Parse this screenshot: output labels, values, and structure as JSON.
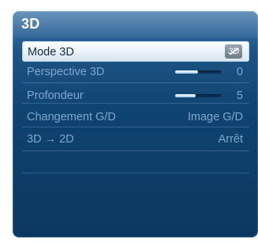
{
  "menu": {
    "title": "3D",
    "items": [
      {
        "label": "Mode 3D",
        "icon": "3d-off-icon",
        "icon_text": "3D",
        "selected": true
      },
      {
        "label": "Perspective 3D",
        "value": "0",
        "slider_fraction": 0.5
      },
      {
        "label": "Profondeur",
        "value": "5",
        "slider_fraction": 0.45
      },
      {
        "label": "Changement G/D",
        "value": "Image G/D"
      },
      {
        "label": "3D → 2D",
        "value": "Arrêt"
      }
    ]
  },
  "colors": {
    "panel": "#0f4370",
    "selected_bg": "#ffffff",
    "dim_text": "#7fa6cb"
  }
}
